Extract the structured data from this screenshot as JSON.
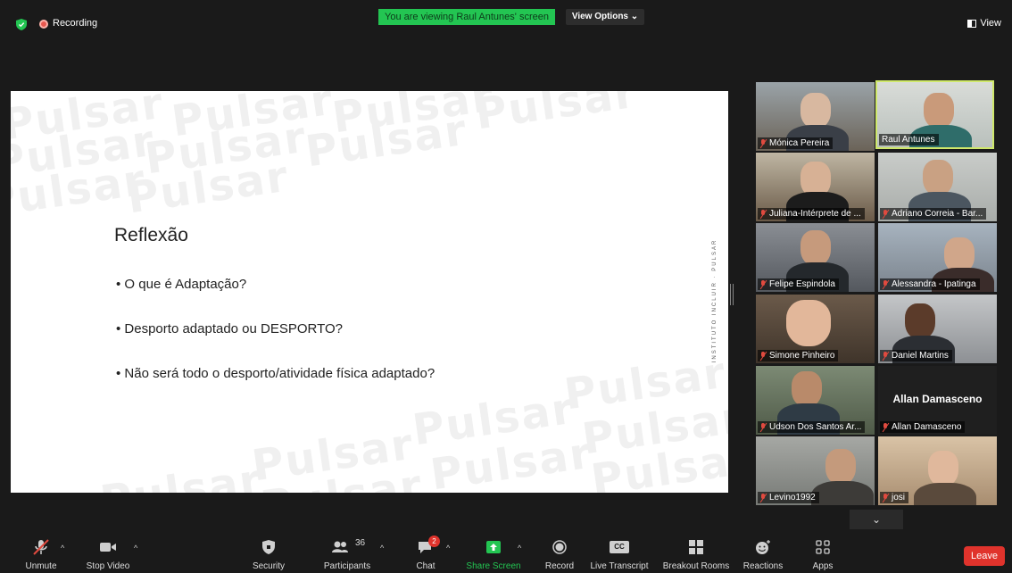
{
  "topbar": {
    "recording_label": "Recording",
    "viewing_banner": "You are viewing Raul Antunes' screen",
    "view_options": "View Options ⌄",
    "view_label": "View"
  },
  "slide": {
    "watermark": "Pulsar",
    "title": "Reflexão",
    "bullets": [
      "• O que é Adaptação?",
      "• Desporto adaptado ou DESPORTO?",
      "• Não será todo o desporto/atividade física adaptado?"
    ],
    "vertical_text": "INSTITUTO INCLUIR · PULSAR"
  },
  "participants": [
    {
      "name": "Mónica Pereira"
    },
    {
      "name": "Raul Antunes"
    },
    {
      "name": "Juliana-Intérprete de ..."
    },
    {
      "name": "Adriano Correia - Bar..."
    },
    {
      "name": "Felipe Espindola"
    },
    {
      "name": "Alessandra - Ipatinga"
    },
    {
      "name": "Simone Pinheiro"
    },
    {
      "name": "Daniel Martins"
    },
    {
      "name": "Udson Dos Santos Ar..."
    },
    {
      "name": "Allan Damasceno",
      "display": "Allan Damasceno"
    },
    {
      "name": "Levino1992"
    },
    {
      "name": "josi"
    }
  ],
  "scroll_chevron": "⌄",
  "toolbar": {
    "unmute": "Unmute",
    "stop_video": "Stop Video",
    "security": "Security",
    "participants": "Participants",
    "participants_count": "36",
    "chat": "Chat",
    "chat_badge": "2",
    "share_screen": "Share Screen",
    "record": "Record",
    "live_transcript": "Live Transcript",
    "cc": "CC",
    "breakout_rooms": "Breakout Rooms",
    "reactions": "Reactions",
    "apps": "Apps",
    "leave": "Leave",
    "caret": "^"
  },
  "colors": {
    "banner_green": "#23c552",
    "share_green": "#23c552",
    "active_speaker": "#cfe86b",
    "leave_red": "#e0332c",
    "muted_red": "#e04a3f"
  }
}
